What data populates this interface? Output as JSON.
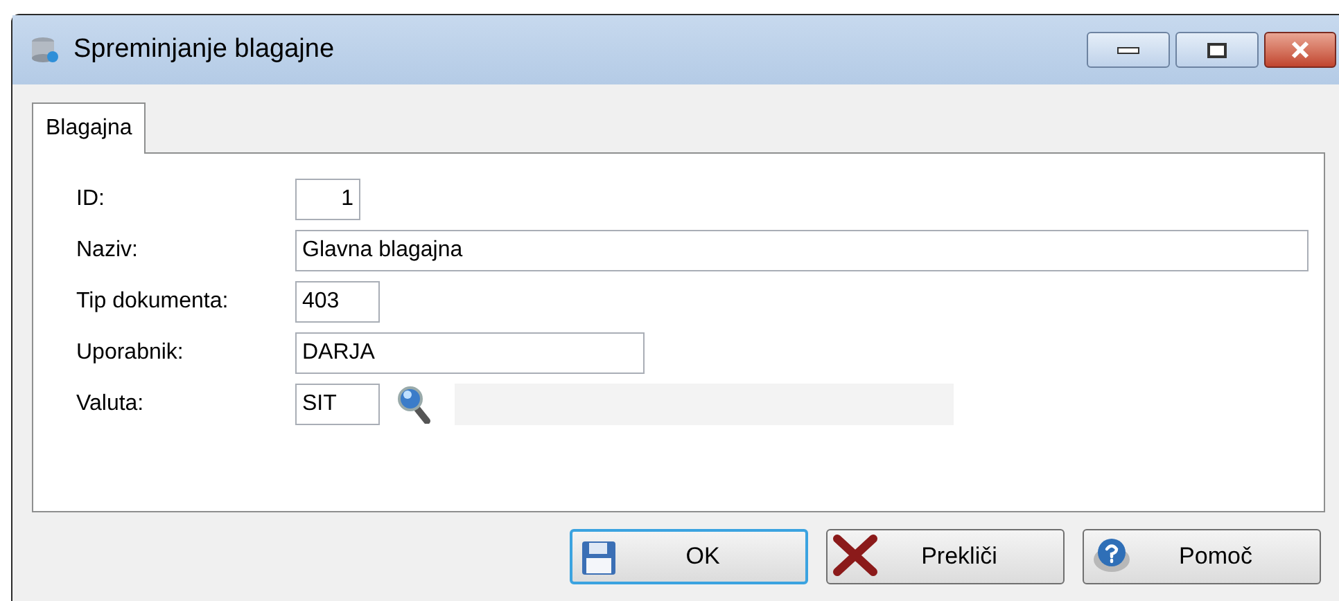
{
  "window": {
    "title": "Spreminjanje blagajne"
  },
  "tabs": [
    {
      "label": "Blagajna",
      "selected": true
    }
  ],
  "fields": [
    {
      "label": "ID:",
      "value": "1",
      "kind": "number"
    },
    {
      "label": "Naziv:",
      "value": "Glavna blagajna",
      "kind": "text"
    },
    {
      "label": "Tip dokumenta:",
      "value": "403",
      "kind": "text"
    },
    {
      "label": "Uporabnik:",
      "value": "DARJA",
      "kind": "text"
    },
    {
      "label": "Valuta:",
      "value": "SIT",
      "kind": "lookup"
    }
  ],
  "buttons": [
    {
      "label": "OK",
      "kind": "save",
      "focused": true
    },
    {
      "label": "Prekliči",
      "kind": "cancel",
      "focused": false
    },
    {
      "label": "Pomoč",
      "kind": "help",
      "focused": false
    }
  ]
}
